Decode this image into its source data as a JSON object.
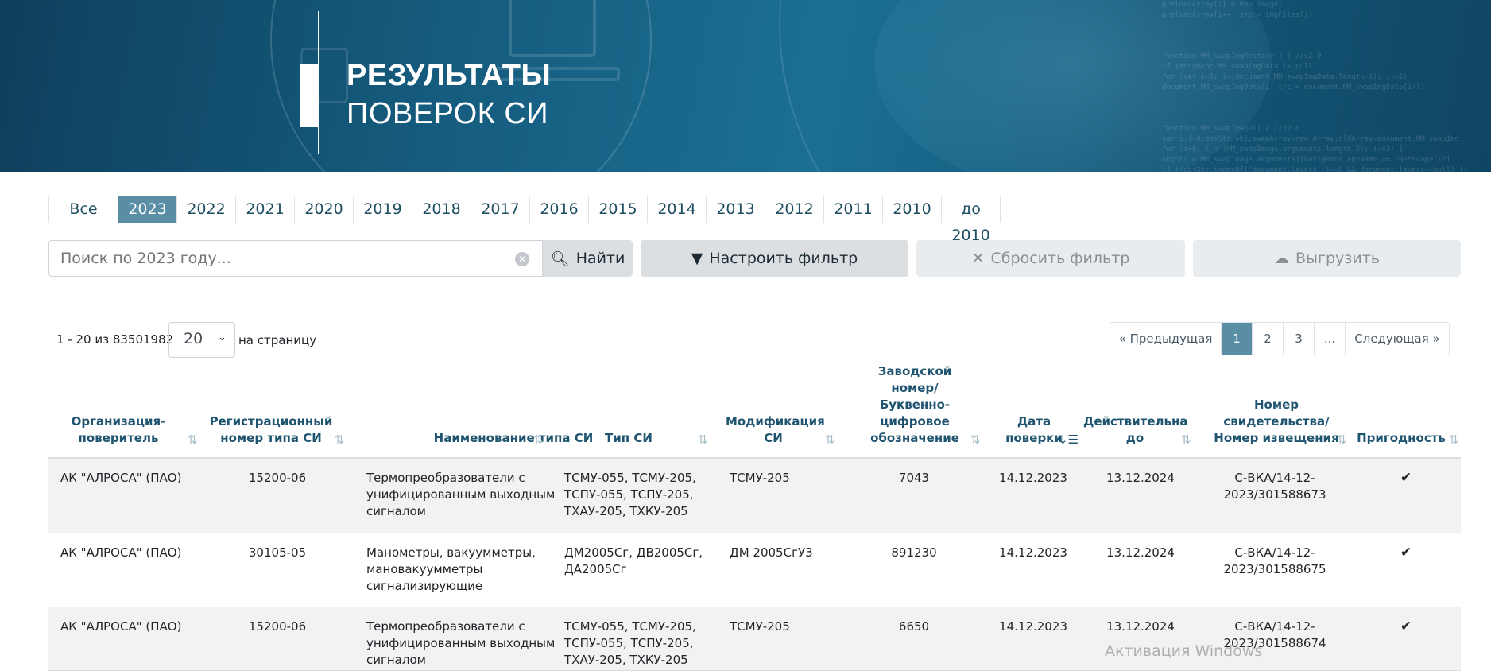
{
  "banner": {
    "title_line1": "РЕЗУЛЬТАТЫ",
    "title_line2": "ПОВЕРОК СИ"
  },
  "years": {
    "items": [
      "Все",
      "2023",
      "2022",
      "2021",
      "2020",
      "2019",
      "2018",
      "2017",
      "2016",
      "2015",
      "2014",
      "2013",
      "2012",
      "2011",
      "2010",
      "до 2010"
    ],
    "active": "2023"
  },
  "search": {
    "placeholder": "Поиск по 2023 году...",
    "find_label": "Найти",
    "filter_label": "Настроить фильтр",
    "reset_label": "Сбросить фильтр",
    "export_label": "Выгрузить"
  },
  "listing": {
    "count_text": "1 - 20 из 83501982",
    "per_page_value": "20",
    "per_page_label": "на страницу"
  },
  "pagination": {
    "prev_label": "Предыдущая",
    "pages": [
      "1",
      "2",
      "3",
      "..."
    ],
    "active_page": "1",
    "next_label": "Следующая"
  },
  "table": {
    "columns": [
      "Организация-\nповеритель",
      "Регистрационный\nномер типа СИ",
      "Наименование типа СИ",
      "Тип СИ",
      "Модификация\nСИ",
      "Заводской номер/\nБуквенно-\nцифровое\nобозначение",
      "Дата\nповерки",
      "Действительна\nдо",
      "Номер\nсвидетельства/\nНомер извещения",
      "Пригодность"
    ],
    "rows": [
      [
        "АК \"АЛРОСА\" (ПАО)",
        "15200-06",
        "Термопреобразователи с\nунифицированным выходным\nсигналом",
        "ТСМУ-055, ТСМУ-205,\nТСПУ-055, ТСПУ-205,\nТХАУ-205, ТХКУ-205",
        "ТСМУ-205",
        "7043",
        "14.12.2023",
        "13.12.2024",
        "С-ВКА/14-12-\n2023/301588673",
        "✔"
      ],
      [
        "АК \"АЛРОСА\" (ПАО)",
        "30105-05",
        "Манометры, вакуумметры,\nмановакуумметры\nсигнализирующие",
        "ДМ2005Сг, ДВ2005Сг,\nДА2005Сг",
        "ДМ 2005СгУ3",
        "891230",
        "14.12.2023",
        "13.12.2024",
        "С-ВКА/14-12-\n2023/301588675",
        "✔"
      ],
      [
        "АК \"АЛРОСА\" (ПАО)",
        "15200-06",
        "Термопреобразователи с\nунифицированным выходным\nсигналом",
        "ТСМУ-055, ТСМУ-205,\nТСПУ-055, ТСПУ-205,\nТХАУ-205, ТХКУ-205",
        "ТСМУ-205",
        "6650",
        "14.12.2023",
        "13.12.2024",
        "С-ВКА/14-12-\n2023/301588674",
        "✔"
      ]
    ]
  },
  "watermark": "Активация Windows"
}
